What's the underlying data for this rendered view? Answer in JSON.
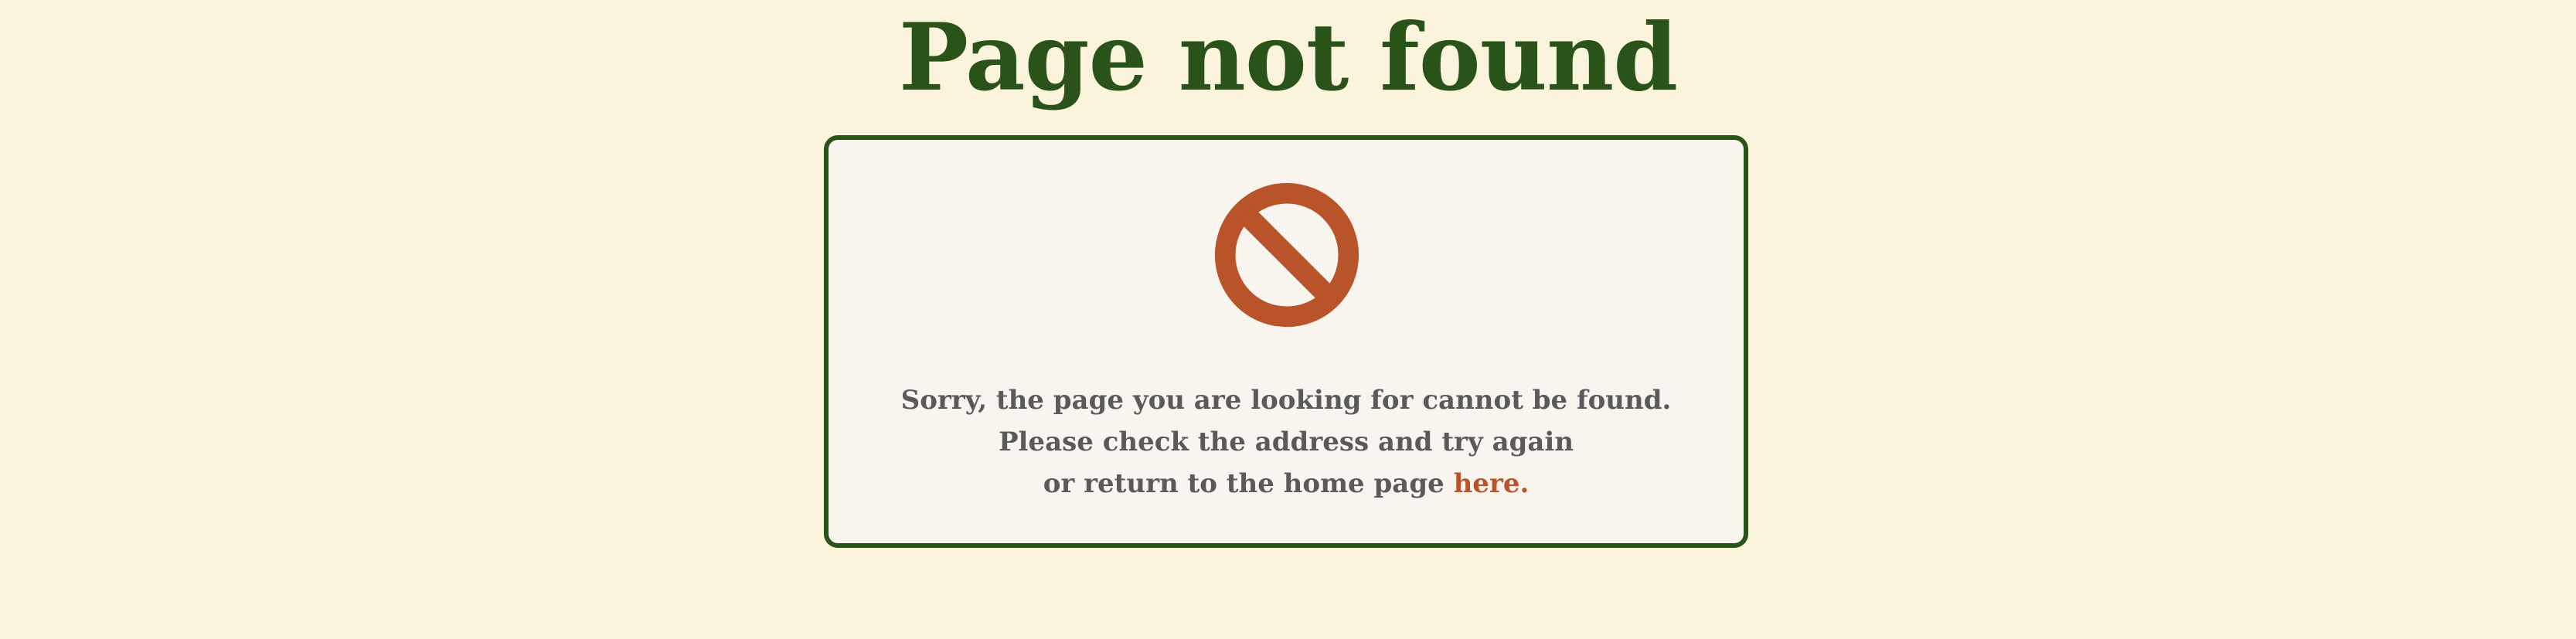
{
  "page": {
    "title": "Page not found"
  },
  "error_card": {
    "icon": "prohibited-icon",
    "message_line_1": "Sorry, the page you are looking for cannot be found.",
    "message_line_2": "Please check the address and try again",
    "message_line_3_prefix": "or return to the home page ",
    "home_link_label": "here."
  },
  "colors": {
    "background": "#fbf4dc",
    "title": "#2a5319",
    "card_border": "#2a5319",
    "card_background": "#f9f5ee",
    "text": "#5a5a5a",
    "accent": "#b8532a"
  }
}
